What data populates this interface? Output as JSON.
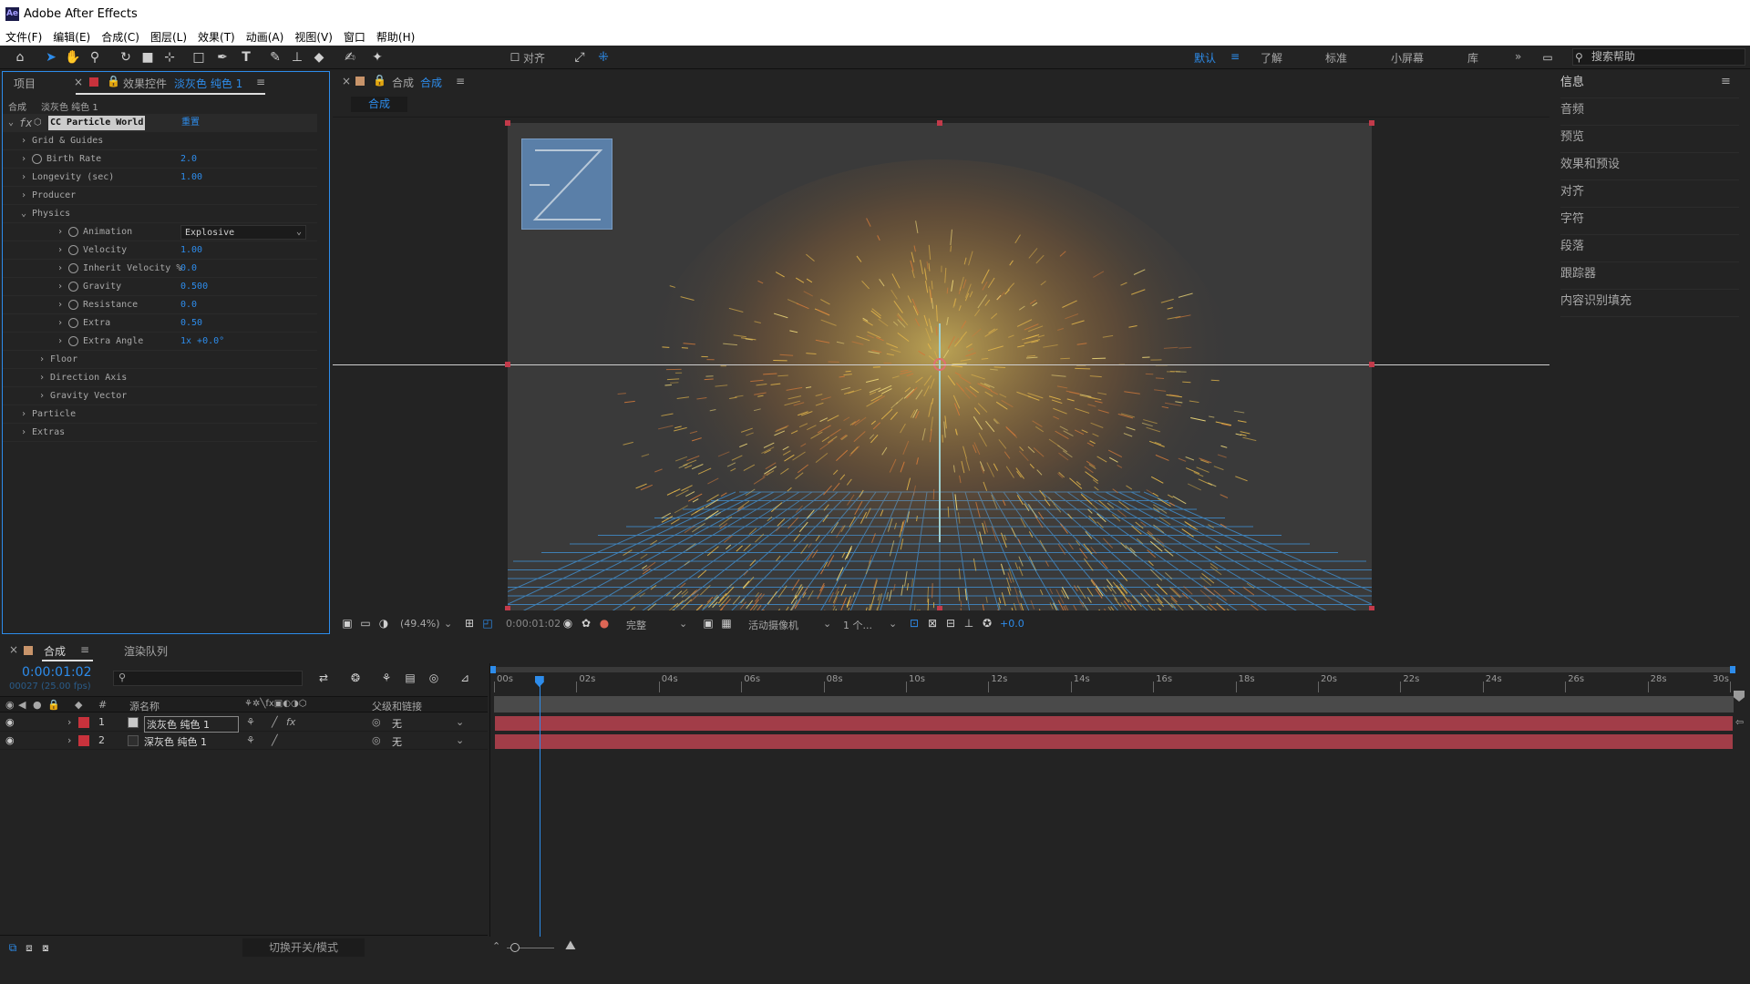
{
  "app": {
    "title": "Adobe After Effects",
    "logo": "Ae"
  },
  "menu": [
    "文件(F)",
    "编辑(E)",
    "合成(C)",
    "图层(L)",
    "效果(T)",
    "动画(A)",
    "视图(V)",
    "窗口",
    "帮助(H)"
  ],
  "toolbar": {
    "align_label": "对齐",
    "workspaces": [
      "默认",
      "了解",
      "标准",
      "小屏幕",
      "库"
    ],
    "search_placeholder": "搜索帮助"
  },
  "project_panel": {
    "tab_project": "项目",
    "tab_effects_prefix": "效果控件",
    "tab_effects_layer": "淡灰色 纯色 1",
    "breadcrumb_comp": "合成",
    "breadcrumb_layer": "淡灰色 纯色 1"
  },
  "effect": {
    "name": "CC Particle World",
    "reset": "重置",
    "props": [
      {
        "label": "Grid & Guides",
        "value": "",
        "indent": 1,
        "stop": false
      },
      {
        "label": "Birth Rate",
        "value": "2.0",
        "indent": 1,
        "stop": true
      },
      {
        "label": "Longevity (sec)",
        "value": "1.00",
        "indent": 1,
        "stop": false
      },
      {
        "label": "Producer",
        "value": "",
        "indent": 1,
        "stop": false
      },
      {
        "label": "Physics",
        "value": "",
        "indent": 1,
        "stop": false,
        "open": true
      },
      {
        "label": "Animation",
        "value": "Explosive",
        "indent": 3,
        "stop": true,
        "dropdown": true
      },
      {
        "label": "Velocity",
        "value": "1.00",
        "indent": 3,
        "stop": true
      },
      {
        "label": "Inherit Velocity %",
        "value": "0.0",
        "indent": 3,
        "stop": true
      },
      {
        "label": "Gravity",
        "value": "0.500",
        "indent": 3,
        "stop": true
      },
      {
        "label": "Resistance",
        "value": "0.0",
        "indent": 3,
        "stop": true
      },
      {
        "label": "Extra",
        "value": "0.50",
        "indent": 3,
        "stop": true
      },
      {
        "label": "Extra Angle",
        "value": "1x +0.0°",
        "indent": 3,
        "stop": true
      },
      {
        "label": "Floor",
        "value": "",
        "indent": 2,
        "stop": false
      },
      {
        "label": "Direction Axis",
        "value": "",
        "indent": 2,
        "stop": false
      },
      {
        "label": "Gravity Vector",
        "value": "",
        "indent": 2,
        "stop": false
      },
      {
        "label": "Particle",
        "value": "",
        "indent": 1,
        "stop": false
      },
      {
        "label": "Extras",
        "value": "",
        "indent": 1,
        "stop": false
      }
    ]
  },
  "viewer": {
    "tab_prefix": "合成",
    "tab_name": "合成",
    "subtab": "合成",
    "zoom": "(49.4%)",
    "timecode": "0:00:01:02",
    "quality": "完整",
    "camera": "活动摄像机",
    "views": "1 个...",
    "exposure": "+0.0"
  },
  "right_panel": [
    "信息",
    "音频",
    "预览",
    "效果和预设",
    "对齐",
    "字符",
    "段落",
    "跟踪器",
    "内容识别填充"
  ],
  "timeline": {
    "tab_comp": "合成",
    "tab_render": "渲染队列",
    "timecode": "0:00:01:02",
    "frame_info": "00027 (25.00 fps)",
    "col_source": "源名称",
    "col_parent": "父级和链接",
    "col_num": "#",
    "ruler": [
      "00s",
      "02s",
      "04s",
      "06s",
      "08s",
      "10s",
      "12s",
      "14s",
      "16s",
      "18s",
      "20s",
      "22s",
      "24s",
      "26s",
      "28s",
      "30s"
    ],
    "layers": [
      {
        "num": "1",
        "name": "淡灰色 纯色 1",
        "parent": "无",
        "color": "#c8c8c8",
        "fx": true
      },
      {
        "num": "2",
        "name": "深灰色 纯色 1",
        "parent": "无",
        "color": "#2e2e2e",
        "fx": false
      }
    ],
    "playhead_fraction": 0.0367
  },
  "statusbar": {
    "toggle": "切换开关/模式"
  },
  "colors": {
    "accent": "#2d8ceb",
    "layer_bar": "#b8424f",
    "label_red": "#c8323c"
  }
}
